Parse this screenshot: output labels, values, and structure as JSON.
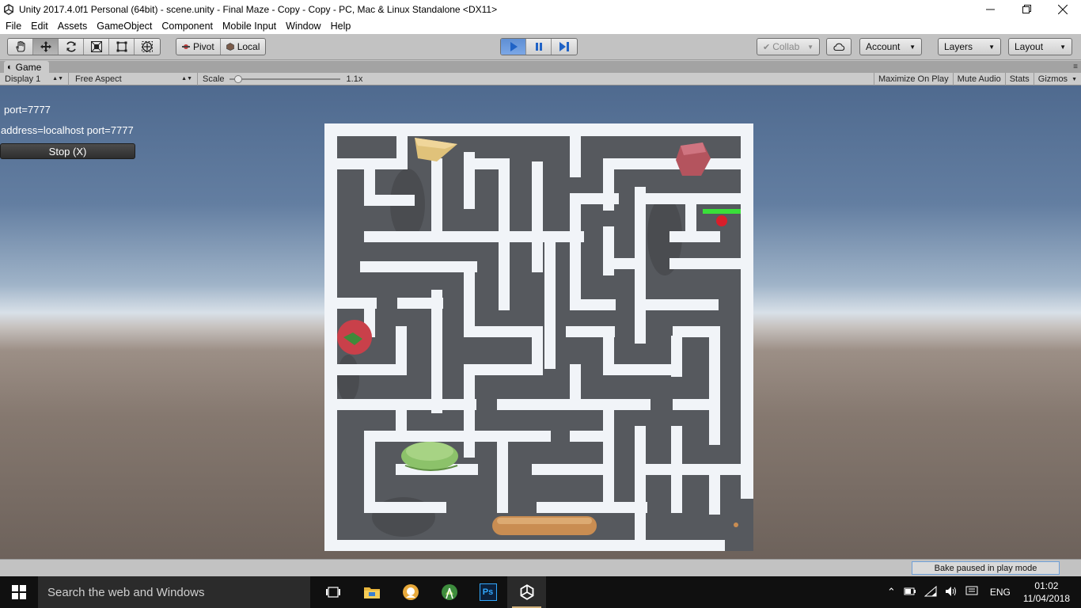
{
  "window": {
    "title": "Unity 2017.4.0f1 Personal (64bit) - scene.unity - Final Maze - Copy - Copy - PC, Mac & Linux Standalone <DX11>",
    "controls": [
      "minimize-icon",
      "restore-icon",
      "close-icon"
    ]
  },
  "menu": [
    "File",
    "Edit",
    "Assets",
    "GameObject",
    "Component",
    "Mobile Input",
    "Window",
    "Help"
  ],
  "toolbar": {
    "transform_tools": [
      "hand-icon",
      "move-icon",
      "rotate-icon",
      "scale-icon",
      "rect-icon",
      "transform-icon"
    ],
    "pivot_label": "Pivot",
    "local_label": "Local",
    "play_controls": [
      "play-icon",
      "pause-icon",
      "step-icon"
    ],
    "collab_label": "Collab",
    "account_label": "Account",
    "layers_label": "Layers",
    "layout_label": "Layout"
  },
  "game_panel": {
    "tab_label": "Game",
    "display": "Display 1",
    "aspect": "Free Aspect",
    "scale_label": "Scale",
    "scale_value": "1.1x",
    "scale_fraction": 0.05,
    "toggles": [
      "Maximize On Play",
      "Mute Audio",
      "Stats",
      "Gizmos"
    ]
  },
  "game_gui": {
    "line1": "port=7777",
    "line2": "address=localhost port=7777",
    "stop_button": "Stop (X)"
  },
  "scene_objects": [
    "cheese",
    "meat",
    "tomato",
    "player-ball",
    "health-bar",
    "tomato-left",
    "lettuce",
    "bread",
    "crumb"
  ],
  "statusbar": {
    "bake_status": "Bake paused in play mode"
  },
  "taskbar": {
    "search_placeholder": "Search the web and Windows",
    "apps": [
      "task-view-icon",
      "file-explorer-icon",
      "app-icon",
      "android-studio-icon",
      "photoshop-icon",
      "unity-icon"
    ],
    "photoshop_label": "Ps",
    "language": "ENG",
    "time": "01:02",
    "date": "11/04/2018"
  },
  "colors": {
    "play_active": "#5f8fd4",
    "maze_wall": "#f2f5f9",
    "maze_floor": "#56595e",
    "health": "#3adf3a"
  }
}
